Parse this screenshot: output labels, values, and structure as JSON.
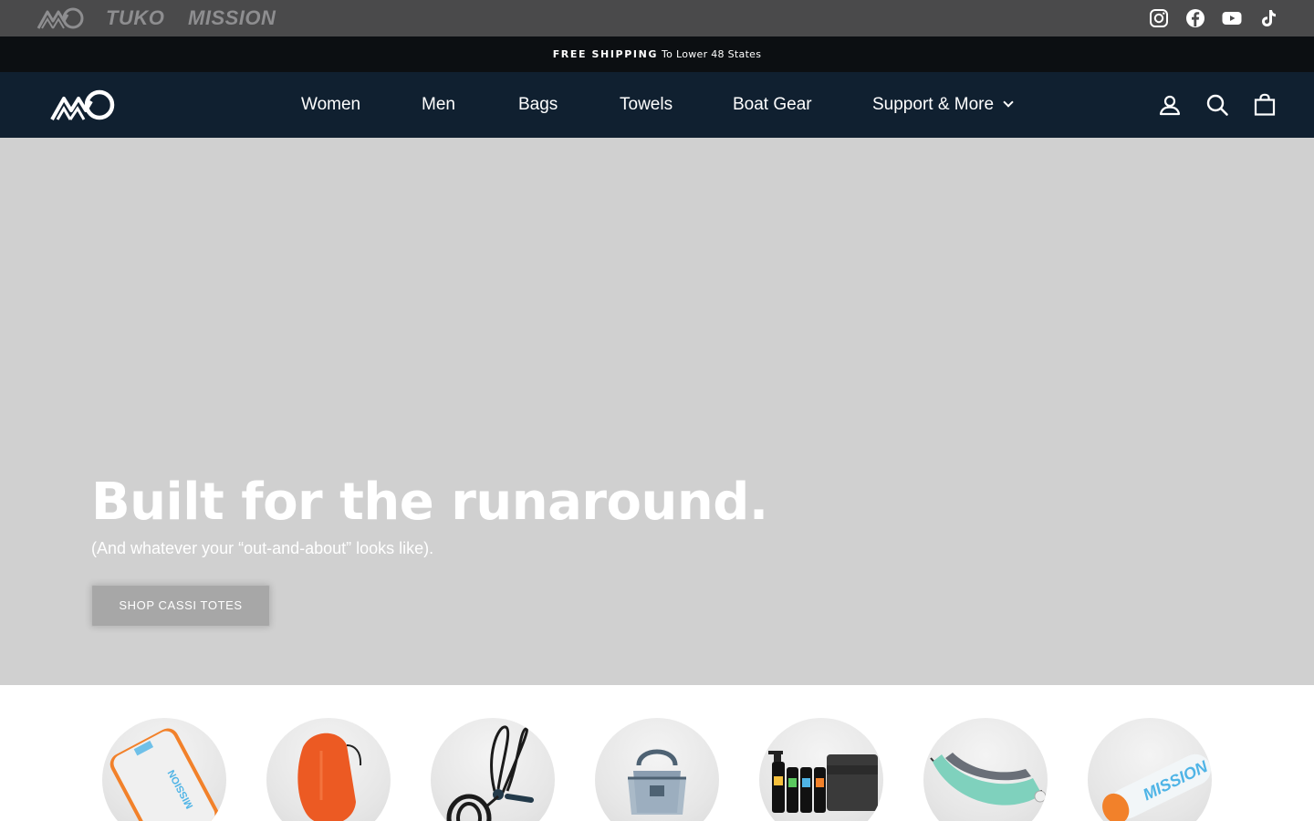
{
  "brand_bar": {
    "brands": [
      {
        "name": "mo-logo",
        "icon": "mo-logo-icon"
      },
      {
        "name": "TUKO"
      },
      {
        "name": "MISSION"
      }
    ],
    "social": [
      "instagram-icon",
      "facebook-icon",
      "youtube-icon",
      "tiktok-icon"
    ]
  },
  "announcement": {
    "strong": "FREE SHIPPING",
    "rest": "To Lower 48 States"
  },
  "nav": {
    "items": [
      "Women",
      "Men",
      "Bags",
      "Towels",
      "Boat Gear",
      "Support & More"
    ],
    "icons": [
      "account-icon",
      "search-icon",
      "cart-icon"
    ]
  },
  "hero": {
    "title": "Built for the runaround.",
    "subtitle": "(And whatever your “out-and-about” looks like).",
    "cta": "SHOP CASSI TOTES",
    "background": "#d0d0d0"
  },
  "categories": [
    {
      "icon": "floating-mat-icon"
    },
    {
      "icon": "boat-fender-icon"
    },
    {
      "icon": "dock-line-icon"
    },
    {
      "icon": "tote-bag-icon"
    },
    {
      "icon": "cleaning-kit-icon"
    },
    {
      "icon": "hammock-icon"
    },
    {
      "icon": "mission-roller-icon"
    }
  ],
  "colors": {
    "brand_bar": "#4a4a4b",
    "announcement": "#0c0f12",
    "nav": "#102030",
    "accent_orange": "#f2812a",
    "accent_blue": "#4fb4e6"
  }
}
